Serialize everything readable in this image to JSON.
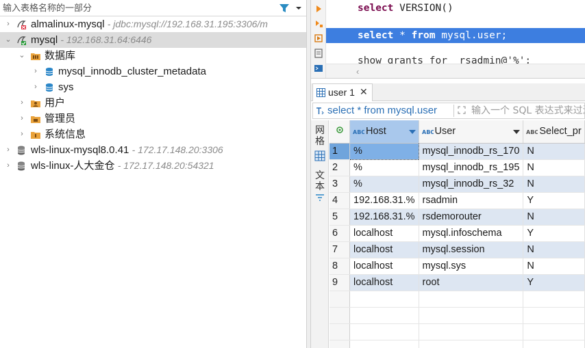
{
  "navigator": {
    "filter_placeholder": "输入表格名称的一部分",
    "tree": [
      {
        "name": "almalinux-mysql",
        "detail": "- jdbc:mysql://192.168.31.195:3306/m",
        "expanded": false,
        "icon": "mysql-disconnected-icon"
      },
      {
        "name": "mysql",
        "detail": "- 192.168.31.64:6446",
        "expanded": true,
        "selected": true,
        "icon": "mysql-connected-icon"
      },
      {
        "name": "数据库",
        "expanded": true,
        "icon": "folder-database-icon"
      },
      {
        "name": "mysql_innodb_cluster_metadata",
        "expanded": false,
        "icon": "database-icon"
      },
      {
        "name": "sys",
        "expanded": false,
        "icon": "database-icon"
      },
      {
        "name": "用户",
        "expanded": false,
        "icon": "folder-users-icon"
      },
      {
        "name": "管理员",
        "expanded": false,
        "icon": "folder-admin-icon"
      },
      {
        "name": "系统信息",
        "expanded": false,
        "icon": "folder-info-icon"
      },
      {
        "name": "wls-linux-mysql8.0.41",
        "detail": "- 172.17.148.20:3306",
        "expanded": false,
        "icon": "server-icon"
      },
      {
        "name": "wls-linux-人大金仓",
        "detail": "- 172.17.148.20:54321",
        "expanded": false,
        "icon": "server-icon"
      }
    ]
  },
  "editor": {
    "line1_kw": "select",
    "line1_rest": " VERSION()",
    "line2_kw": "select",
    "line2_mid": " * ",
    "line2_kw2": "from",
    "line2_rest": " mysql.user;",
    "line3": "show grants for  rsadmin@'%';"
  },
  "results": {
    "tab_label": "user 1",
    "tab_close": "✕",
    "query_text": "select * from mysql.user",
    "filter_placeholder": "输入一个 SQL 表达式来过滤",
    "side_grid": "网格",
    "side_text": "文本",
    "columns": [
      "Host",
      "User",
      "Select_pr"
    ],
    "rows": [
      [
        "1",
        "%",
        "mysql_innodb_rs_170",
        "N"
      ],
      [
        "2",
        "%",
        "mysql_innodb_rs_195",
        "N"
      ],
      [
        "3",
        "%",
        "mysql_innodb_rs_32",
        "N"
      ],
      [
        "4",
        "192.168.31.%",
        "rsadmin",
        "Y"
      ],
      [
        "5",
        "192.168.31.%",
        "rsdemorouter",
        "N"
      ],
      [
        "6",
        "localhost",
        "mysql.infoschema",
        "Y"
      ],
      [
        "7",
        "localhost",
        "mysql.session",
        "N"
      ],
      [
        "8",
        "localhost",
        "mysql.sys",
        "N"
      ],
      [
        "9",
        "localhost",
        "root",
        "Y"
      ]
    ]
  },
  "colors": {
    "selection": "#3d7ee0",
    "keyword": "#7a0a4e",
    "query_link": "#2a6fb5",
    "row_stripe": "#dde6f2"
  }
}
